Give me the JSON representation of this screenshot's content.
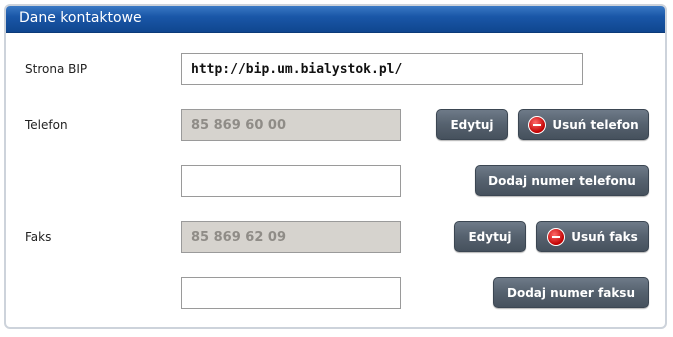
{
  "panel": {
    "title": "Dane kontaktowe"
  },
  "bip": {
    "label": "Strona BIP",
    "value": "http://bip.um.bialystok.pl/"
  },
  "phone": {
    "label": "Telefon",
    "value": "85 869 60 00",
    "edit_label": "Edytuj",
    "remove_label": "Usuń telefon",
    "new_value": "",
    "add_label": "Dodaj numer telefonu"
  },
  "fax": {
    "label": "Faks",
    "value": "85 869 62 09",
    "edit_label": "Edytuj",
    "remove_label": "Usuń faks",
    "new_value": "",
    "add_label": "Dodaj numer faksu"
  },
  "icons": {
    "remove": "minus-circle-icon"
  },
  "colors": {
    "header": "#1a57a8",
    "button": "#55616e",
    "remove_icon": "#c00000",
    "readonly_field": "#d6d3ce"
  }
}
